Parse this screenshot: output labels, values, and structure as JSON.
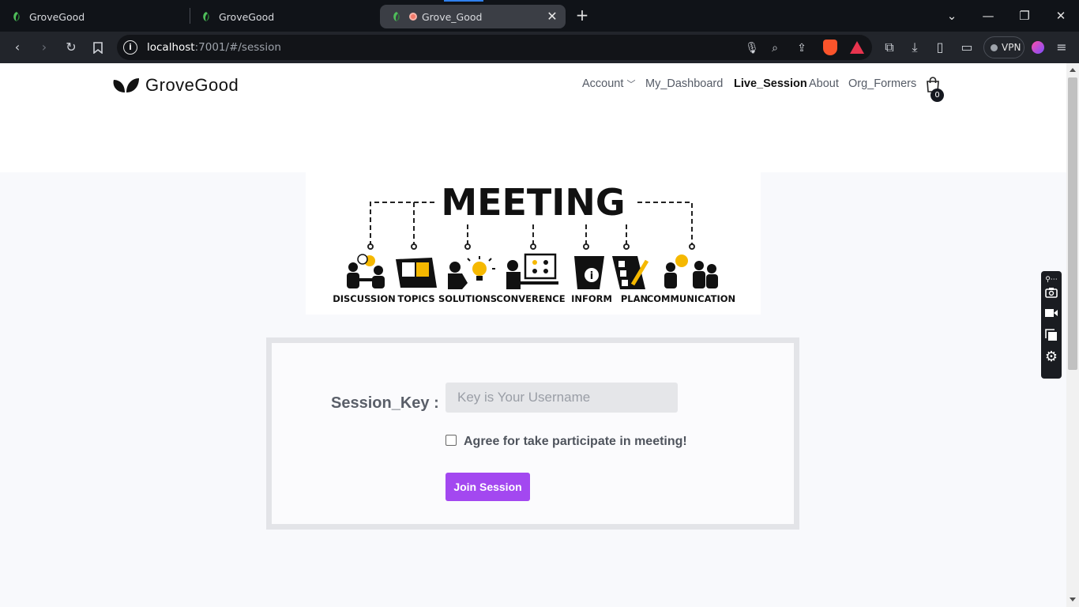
{
  "browser": {
    "tabs": [
      {
        "title": "GroveGood"
      },
      {
        "title": "GroveGood"
      },
      {
        "title": "Grove_Good"
      }
    ],
    "url_host": "localhost",
    "url_path": ":7001/#/session",
    "vpn_label": "VPN"
  },
  "site": {
    "brand": "GroveGood",
    "nav": [
      {
        "label": "Account"
      },
      {
        "label": "My_Dashboard"
      },
      {
        "label": "Live_Session"
      },
      {
        "label": "About"
      },
      {
        "label": "Org_Formers"
      }
    ],
    "cart_count": "0"
  },
  "banner": {
    "title": "MEETING",
    "items": [
      "DISCUSSION",
      "TOPICS",
      "SOLUTIONS",
      "CONVERENCE",
      "INFORM",
      "PLAN",
      "COMMUNICATION"
    ]
  },
  "session_form": {
    "label": "Session_Key :",
    "input_placeholder": "Key is Your Username",
    "input_value": "",
    "agree_label": "Agree for take participate in meeting!",
    "agree_checked": false,
    "join_label": "Join Session"
  },
  "colors": {
    "accent": "#a348f0",
    "tab_bg": "#101318",
    "toolbar_bg": "#22252b"
  },
  "icons": [
    "grove-leaf-icon",
    "shopping-bag-icon",
    "camera-icon",
    "video-icon",
    "copy-icon",
    "gear-icon"
  ]
}
